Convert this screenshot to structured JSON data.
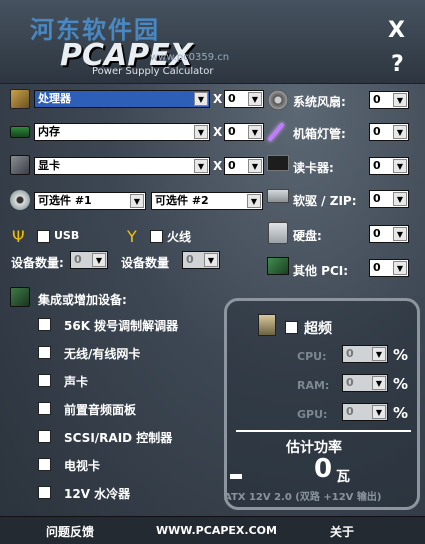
{
  "watermark": "河东软件园",
  "header": {
    "logo": "PCAPEX",
    "subtitle": "Power Supply Calculator",
    "small_url": "www.pc0359.cn",
    "close": "X",
    "help": "?"
  },
  "left_rows": [
    {
      "icon": "cpu-icon",
      "value": "处理器",
      "qty": "0",
      "highlight": true
    },
    {
      "icon": "memory-icon",
      "value": "内存",
      "qty": "0",
      "highlight": false
    },
    {
      "icon": "graphics-card-icon",
      "value": "显卡",
      "qty": "0",
      "highlight": false
    }
  ],
  "x_label": "X",
  "optional": {
    "opt1": "可选件 #1",
    "opt2": "可选件 #2"
  },
  "usb": {
    "label": "USB",
    "count_label": "设备数量:",
    "count": "0"
  },
  "firewire": {
    "label": "火线",
    "count_label": "设备数量",
    "count": "0"
  },
  "right_rows": [
    {
      "icon": "fan-icon",
      "label": "系统风扇:",
      "qty": "0"
    },
    {
      "icon": "cold-cathode-icon",
      "label": "机箱灯管:",
      "qty": "0"
    },
    {
      "icon": "card-reader-icon",
      "label": "读卡器:",
      "qty": "0"
    },
    {
      "icon": "floppy-zip-icon",
      "label": "软驱 / ZIP:",
      "qty": "0"
    },
    {
      "icon": "hard-disk-icon",
      "label": "硬盘:",
      "qty": "0"
    },
    {
      "icon": "pci-card-icon",
      "label": "其他 PCI:",
      "qty": "0"
    }
  ],
  "integrated": {
    "title": "集成或增加设备:",
    "items": [
      "56K 拨号调制解调器",
      "无线/有线网卡",
      "声卡",
      "前置音频面板",
      "SCSI/RAID 控制器",
      "电视卡",
      "12V 水冷器"
    ]
  },
  "overclock": {
    "label": "超频",
    "fields": [
      {
        "label": "CPU:",
        "value": "0"
      },
      {
        "label": "RAM:",
        "value": "0"
      },
      {
        "label": "GPU:",
        "value": "0"
      }
    ],
    "pct": "%"
  },
  "result": {
    "label": "估计功率",
    "value": "0",
    "unit": "瓦",
    "note": "ATX 12V 2.0 (双路 +12V 输出)"
  },
  "footer": {
    "feedback": "问题反馈",
    "site": "WWW.PCAPEX.COM",
    "about": "关于"
  }
}
